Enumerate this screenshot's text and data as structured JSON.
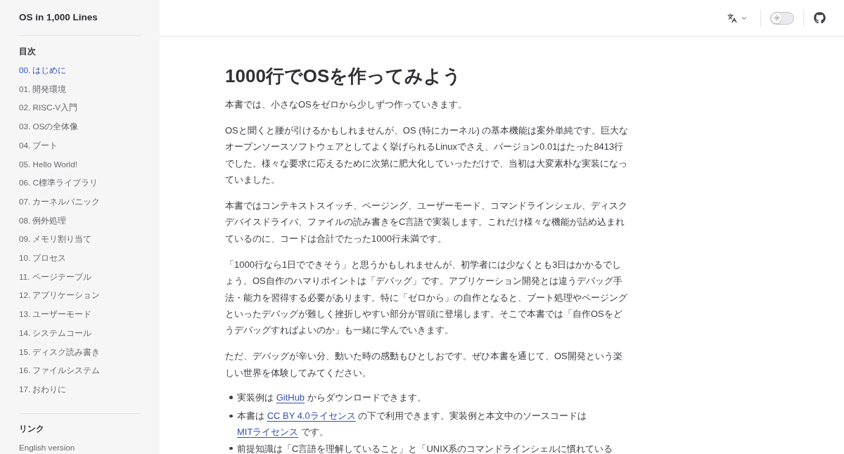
{
  "sidebar": {
    "title": "OS in 1,000 Lines",
    "sections": [
      {
        "heading": "目次",
        "items": [
          {
            "label": "00. はじめに",
            "selected": true
          },
          {
            "label": "01. 開発環境",
            "selected": false
          },
          {
            "label": "02. RISC-V入門",
            "selected": false
          },
          {
            "label": "03. OSの全体像",
            "selected": false
          },
          {
            "label": "04. ブート",
            "selected": false
          },
          {
            "label": "05. Hello World!",
            "selected": false
          },
          {
            "label": "06. C標準ライブラリ",
            "selected": false
          },
          {
            "label": "07. カーネルパニック",
            "selected": false
          },
          {
            "label": "08. 例外処理",
            "selected": false
          },
          {
            "label": "09. メモリ割り当て",
            "selected": false
          },
          {
            "label": "10. プロセス",
            "selected": false
          },
          {
            "label": "11. ページテーブル",
            "selected": false
          },
          {
            "label": "12. アプリケーション",
            "selected": false
          },
          {
            "label": "13. ユーザーモード",
            "selected": false
          },
          {
            "label": "14. システムコール",
            "selected": false
          },
          {
            "label": "15. ディスク読み書き",
            "selected": false
          },
          {
            "label": "16. ファイルシステム",
            "selected": false
          },
          {
            "label": "17. おわりに",
            "selected": false
          }
        ]
      },
      {
        "heading": "リンク",
        "items": [
          {
            "label": "English version",
            "selected": false
          }
        ]
      }
    ]
  },
  "top_bar": {
    "appearance_switch": {
      "on": false
    }
  },
  "article": {
    "title": "1000行でOSを作ってみよう",
    "paragraphs": [
      "本書では、小さなOSをゼロから少しずつ作っていきます。",
      "OSと聞くと腰が引けるかもしれませんが、OS (特にカーネル) の基本機能は案外単純です。巨大なオープンソースソフトウェアとしてよく挙げられるLinuxでさえ、バージョン0.01はたった8413行でした。様々な要求に応えるために次第に肥大化していっただけで、当初は大変素朴な実装になっていました。",
      "本書ではコンテキストスイッチ、ページング、ユーザーモード、コマンドラインシェル、ディスクデバイスドライバ、ファイルの読み書きをC言語で実装します。これだけ様々な機能が詰め込まれているのに、コードは合計でたった1000行未満です。",
      "「1000行なら1日でできそう」と思うかもしれませんが、初学者には少なくとも3日はかかるでしょう。OS自作のハマりポイントは「デバッグ」です。アプリケーション開発とは違うデバッグ手法・能力を習得する必要があります。特に「ゼロから」の自作となると、ブート処理やページングといったデバッグが難しく挫折しやすい部分が冒頭に登場します。そこで本書では「自作OSをどうデバッグすればよいのか」も一緒に学んでいきます。",
      "ただ、デバッグが辛い分、動いた時の感動もひとしおです。ぜひ本書を通じて、OS開発という楽しい世界を体験してみてください。"
    ],
    "list": [
      {
        "parts": [
          {
            "kind": "text",
            "text": "実装例は "
          },
          {
            "kind": "link",
            "text": "GitHub"
          },
          {
            "kind": "text",
            "text": " からダウンロードできます。"
          }
        ]
      },
      {
        "parts": [
          {
            "kind": "text",
            "text": "本書は "
          },
          {
            "kind": "link",
            "text": "CC BY 4.0ライセンス"
          },
          {
            "kind": "text",
            "text": " の下で利用できます。実装例と本文中のソースコードは "
          },
          {
            "kind": "link",
            "text": "MITライセンス"
          },
          {
            "kind": "text",
            "text": " です。"
          }
        ]
      },
      {
        "parts": [
          {
            "kind": "text",
            "text": "前提知識は「C言語を理解していること」と「UNIX系のコマンドラインシェルに慣れている"
          }
        ]
      }
    ]
  }
}
